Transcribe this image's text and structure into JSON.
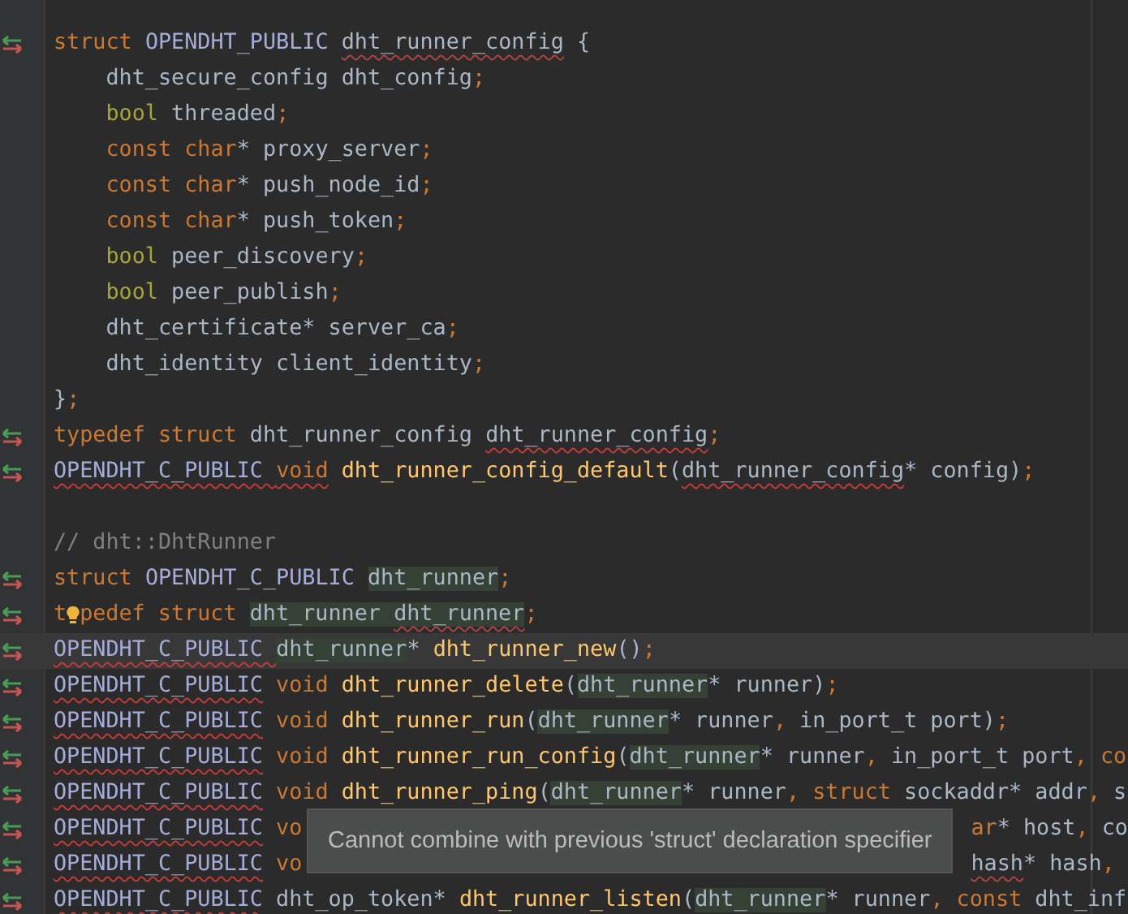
{
  "editor": {
    "lines": [
      {
        "kind": "code",
        "marker": true,
        "current": false,
        "segments": [
          [
            {
              "text": "struct ",
              "kind": "kw"
            },
            {
              "text": "OPENDHT_PUBLIC ",
              "kind": "macro"
            },
            {
              "text": "dht_runner_config",
              "kind": "plain",
              "err": true
            },
            {
              "text": " {",
              "kind": "plain"
            }
          ]
        ]
      },
      {
        "kind": "code",
        "marker": false,
        "current": false,
        "segments": [
          [
            {
              "text": "    dht_secure_config dht_config",
              "kind": "plain"
            },
            {
              "text": ";",
              "kind": "punct"
            }
          ]
        ]
      },
      {
        "kind": "code",
        "marker": false,
        "current": false,
        "segments": [
          [
            {
              "text": "    bool",
              "kind": "kw2"
            },
            {
              "text": " threaded",
              "kind": "plain"
            },
            {
              "text": ";",
              "kind": "punct"
            }
          ]
        ]
      },
      {
        "kind": "code",
        "marker": false,
        "current": false,
        "segments": [
          [
            {
              "text": "    const char",
              "kind": "kw"
            },
            {
              "text": "* proxy_server",
              "kind": "plain"
            },
            {
              "text": ";",
              "kind": "punct"
            }
          ]
        ]
      },
      {
        "kind": "code",
        "marker": false,
        "current": false,
        "segments": [
          [
            {
              "text": "    const char",
              "kind": "kw"
            },
            {
              "text": "* push_node_id",
              "kind": "plain"
            },
            {
              "text": ";",
              "kind": "punct"
            }
          ]
        ]
      },
      {
        "kind": "code",
        "marker": false,
        "current": false,
        "segments": [
          [
            {
              "text": "    const char",
              "kind": "kw"
            },
            {
              "text": "* push_token",
              "kind": "plain"
            },
            {
              "text": ";",
              "kind": "punct"
            }
          ]
        ]
      },
      {
        "kind": "code",
        "marker": false,
        "current": false,
        "segments": [
          [
            {
              "text": "    bool",
              "kind": "kw2"
            },
            {
              "text": " peer_discovery",
              "kind": "plain"
            },
            {
              "text": ";",
              "kind": "punct"
            }
          ]
        ]
      },
      {
        "kind": "code",
        "marker": false,
        "current": false,
        "segments": [
          [
            {
              "text": "    bool",
              "kind": "kw2"
            },
            {
              "text": " peer_publish",
              "kind": "plain"
            },
            {
              "text": ";",
              "kind": "punct"
            }
          ]
        ]
      },
      {
        "kind": "code",
        "marker": false,
        "current": false,
        "segments": [
          [
            {
              "text": "    dht_certificate* server_ca",
              "kind": "plain"
            },
            {
              "text": ";",
              "kind": "punct"
            }
          ]
        ]
      },
      {
        "kind": "code",
        "marker": false,
        "current": false,
        "segments": [
          [
            {
              "text": "    dht_identity client_identity",
              "kind": "plain"
            },
            {
              "text": ";",
              "kind": "punct"
            }
          ]
        ]
      },
      {
        "kind": "code",
        "marker": false,
        "current": false,
        "segments": [
          [
            {
              "text": "}",
              "kind": "plain"
            },
            {
              "text": ";",
              "kind": "punct"
            }
          ]
        ]
      },
      {
        "kind": "code",
        "marker": true,
        "current": false,
        "segments": [
          [
            {
              "text": "typedef struct",
              "kind": "kw"
            },
            {
              "text": " dht_runner_config ",
              "kind": "plain"
            },
            {
              "text": "dht_runner_config",
              "kind": "plain",
              "err": true
            },
            {
              "text": ";",
              "kind": "punct"
            }
          ]
        ]
      },
      {
        "kind": "code",
        "marker": true,
        "current": false,
        "segments": [
          [
            {
              "text": "OPENDHT_C_PUBLIC ",
              "kind": "macro",
              "err": true
            },
            {
              "text": "void",
              "kind": "kw",
              "err": true
            },
            {
              "text": " dht_runner_config_default",
              "kind": "fn"
            },
            {
              "text": "(",
              "kind": "plain"
            },
            {
              "text": "dht_runner_config",
              "kind": "plain",
              "err": true
            },
            {
              "text": "* config)",
              "kind": "plain"
            },
            {
              "text": ";",
              "kind": "punct"
            }
          ]
        ]
      },
      {
        "kind": "blank",
        "marker": false,
        "current": false
      },
      {
        "kind": "code",
        "marker": false,
        "current": false,
        "segments": [
          [
            {
              "text": "// dht::DhtRunner",
              "kind": "comment"
            }
          ]
        ]
      },
      {
        "kind": "code",
        "marker": true,
        "current": false,
        "segments": [
          [
            {
              "text": "struct ",
              "kind": "kw"
            },
            {
              "text": "OPENDHT_C_PUBLIC ",
              "kind": "macro"
            },
            {
              "text": "dht_runner",
              "kind": "plain",
              "hl": true
            },
            {
              "text": ";",
              "kind": "punct"
            }
          ]
        ]
      },
      {
        "kind": "code",
        "marker": true,
        "current": false,
        "bulb": true,
        "segments": [
          [
            {
              "text": "t",
              "kind": "kw"
            }
          ],
          [
            {
              "text": "pedef struct ",
              "kind": "kw"
            },
            {
              "text": "dht_runner ",
              "kind": "plain",
              "hl": true
            },
            {
              "text": "dht_runner",
              "kind": "plain",
              "hl": true,
              "err": true
            },
            {
              "text": ";",
              "kind": "punct"
            }
          ]
        ]
      },
      {
        "kind": "code",
        "marker": true,
        "current": true,
        "segments": [
          [
            {
              "text": "OPENDHT_C_PUBLIC ",
              "kind": "macro",
              "err": true
            },
            {
              "text": "dht_runner",
              "kind": "plain",
              "hl": true
            },
            {
              "text": "* ",
              "kind": "plain"
            },
            {
              "text": "dht_runner_new",
              "kind": "fn"
            },
            {
              "text": "()",
              "kind": "plain"
            },
            {
              "text": ";",
              "kind": "punct"
            }
          ]
        ]
      },
      {
        "kind": "code",
        "marker": true,
        "current": false,
        "segments": [
          [
            {
              "text": "OPENDHT_C_PUBLIC",
              "kind": "macro",
              "err": true
            },
            {
              "text": " void",
              "kind": "kw"
            },
            {
              "text": " dht_runner_delete",
              "kind": "fn"
            },
            {
              "text": "(",
              "kind": "plain"
            },
            {
              "text": "dht_runner",
              "kind": "plain",
              "hl": true
            },
            {
              "text": "* runner)",
              "kind": "plain"
            },
            {
              "text": ";",
              "kind": "punct"
            }
          ]
        ]
      },
      {
        "kind": "code",
        "marker": true,
        "current": false,
        "segments": [
          [
            {
              "text": "OPENDHT_C_PUBLIC",
              "kind": "macro",
              "err": true
            },
            {
              "text": " void",
              "kind": "kw"
            },
            {
              "text": " dht_runner_run",
              "kind": "fn"
            },
            {
              "text": "(",
              "kind": "plain"
            },
            {
              "text": "dht_runner",
              "kind": "plain",
              "hl": true
            },
            {
              "text": "* runner",
              "kind": "plain"
            },
            {
              "text": ",",
              "kind": "punct"
            },
            {
              "text": " in_port_t port)",
              "kind": "plain"
            },
            {
              "text": ";",
              "kind": "punct"
            }
          ]
        ]
      },
      {
        "kind": "code",
        "marker": true,
        "current": false,
        "segments": [
          [
            {
              "text": "OPENDHT_C_PUBLIC",
              "kind": "macro",
              "err": true
            },
            {
              "text": " void",
              "kind": "kw"
            },
            {
              "text": " dht_runner_run_config",
              "kind": "fn"
            },
            {
              "text": "(",
              "kind": "plain"
            },
            {
              "text": "dht_runner",
              "kind": "plain",
              "hl": true
            },
            {
              "text": "* runner",
              "kind": "plain"
            },
            {
              "text": ",",
              "kind": "punct"
            },
            {
              "text": " in_port_t port",
              "kind": "plain"
            },
            {
              "text": ",",
              "kind": "punct"
            },
            {
              "text": " co",
              "kind": "kw"
            }
          ]
        ]
      },
      {
        "kind": "code",
        "marker": true,
        "current": false,
        "segments": [
          [
            {
              "text": "OPENDHT_C_PUBLIC",
              "kind": "macro",
              "err": true
            },
            {
              "text": " void",
              "kind": "kw"
            },
            {
              "text": " dht_runner_ping",
              "kind": "fn"
            },
            {
              "text": "(",
              "kind": "plain"
            },
            {
              "text": "dht_runner",
              "kind": "plain",
              "hl": true
            },
            {
              "text": "* runner",
              "kind": "plain"
            },
            {
              "text": ",",
              "kind": "punct"
            },
            {
              "text": " struct",
              "kind": "kw"
            },
            {
              "text": " sockaddr* addr",
              "kind": "plain"
            },
            {
              "text": ",",
              "kind": "punct"
            },
            {
              "text": " s",
              "kind": "plain"
            }
          ]
        ]
      },
      {
        "kind": "covered",
        "marker": true,
        "current": false,
        "segments": [
          [
            {
              "text": "OPENDHT_C_PUBLIC",
              "kind": "macro",
              "err": true
            },
            {
              "text": " vo",
              "kind": "kw"
            }
          ],
          [
            {
              "text": "ar",
              "kind": "kw"
            },
            {
              "text": "* host",
              "kind": "plain"
            },
            {
              "text": ",",
              "kind": "punct"
            },
            {
              "text": " co",
              "kind": "plain"
            }
          ]
        ]
      },
      {
        "kind": "covered",
        "marker": true,
        "current": false,
        "segments": [
          [
            {
              "text": "OPENDHT_C_PUBLIC",
              "kind": "macro",
              "err": true
            },
            {
              "text": " vo",
              "kind": "kw"
            }
          ],
          [
            {
              "text": "hash",
              "kind": "plain",
              "err": true
            },
            {
              "text": "* hash",
              "kind": "plain"
            },
            {
              "text": ", ",
              "kind": "punct"
            }
          ]
        ]
      },
      {
        "kind": "code",
        "marker": true,
        "current": false,
        "segments": [
          [
            {
              "text": "OPENDHT_C_PUBLIC",
              "kind": "macro",
              "err": true
            },
            {
              "text": " dht_op_token* ",
              "kind": "plain"
            },
            {
              "text": "dht_runner_listen",
              "kind": "fn"
            },
            {
              "text": "(",
              "kind": "plain"
            },
            {
              "text": "dht_runner",
              "kind": "plain",
              "hl": true
            },
            {
              "text": "* runner",
              "kind": "plain"
            },
            {
              "text": ",",
              "kind": "punct"
            },
            {
              "text": " const",
              "kind": "kw"
            },
            {
              "text": " dht_inf",
              "kind": "plain"
            }
          ]
        ]
      }
    ]
  },
  "tooltip": {
    "text": "Cannot combine with previous 'struct' declaration specifier"
  }
}
